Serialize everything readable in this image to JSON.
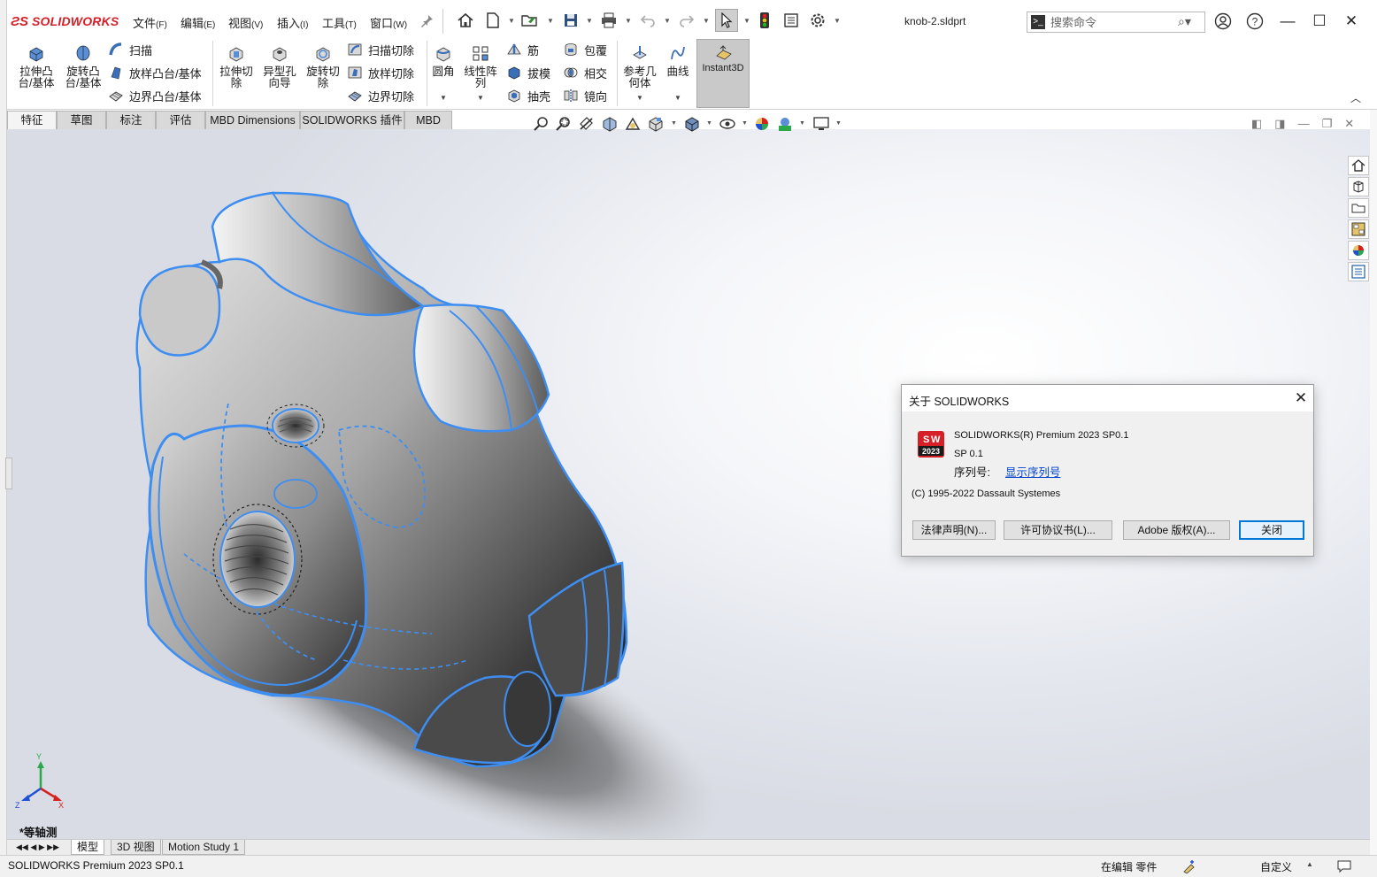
{
  "titlebar": {
    "brand": "SOLIDWORKS",
    "menus": [
      {
        "label": "文件",
        "key": "(F)"
      },
      {
        "label": "编辑",
        "key": "(E)"
      },
      {
        "label": "视图",
        "key": "(V)"
      },
      {
        "label": "插入",
        "key": "(I)"
      },
      {
        "label": "工具",
        "key": "(T)"
      },
      {
        "label": "窗口",
        "key": "(W)"
      }
    ],
    "filename": "knob-2.sldprt",
    "search_placeholder": "搜索命令"
  },
  "commands": {
    "extrude_boss": "拉伸凸台/基体",
    "revolve_boss": "旋转凸台/基体",
    "sweep": "扫描",
    "loft_boss": "放样凸台/基体",
    "boundary_boss": "边界凸台/基体",
    "extrude_cut": "拉伸切除",
    "hole_wizard": "异型孔向导",
    "revolve_cut": "旋转切除",
    "sweep_cut": "扫描切除",
    "loft_cut": "放样切除",
    "boundary_cut": "边界切除",
    "fillet": "圆角",
    "linear_pattern": "线性阵列",
    "rib": "筋",
    "draft": "拔模",
    "shell": "抽壳",
    "wrap": "包覆",
    "intersect": "相交",
    "mirror": "镜向",
    "ref_geometry": "参考几何体",
    "curves": "曲线",
    "instant3d": "Instant3D"
  },
  "tabs": [
    "特征",
    "草图",
    "标注",
    "评估",
    "MBD Dimensions",
    "SOLIDWORKS 插件",
    "MBD"
  ],
  "dialog": {
    "title": "关于 SOLIDWORKS",
    "product": "SOLIDWORKS(R) Premium 2023 SP0.1",
    "sp": "SP 0.1",
    "serial_label": "序列号:",
    "serial_link": "显示序列号",
    "copyright": "(C) 1995-2022 Dassault Systemes",
    "logo_year": "2023",
    "buttons": {
      "legal": "法律声明(N)...",
      "license": "许可协议书(L)...",
      "adobe": "Adobe 版权(A)...",
      "close": "关闭"
    }
  },
  "viewport": {
    "view_name": "*等轴测",
    "triad": {
      "x": "X",
      "y": "Y",
      "z": "Z"
    }
  },
  "bottom_tabs": [
    "模型",
    "3D 视图",
    "Motion Study 1"
  ],
  "status": {
    "product": "SOLIDWORKS Premium 2023 SP0.1",
    "mode": "在编辑 零件",
    "units": "自定义"
  },
  "colors": {
    "brand_red": "#d62027",
    "edge_blue": "#3e8ef2",
    "dialog_accent": "#0078d7"
  }
}
